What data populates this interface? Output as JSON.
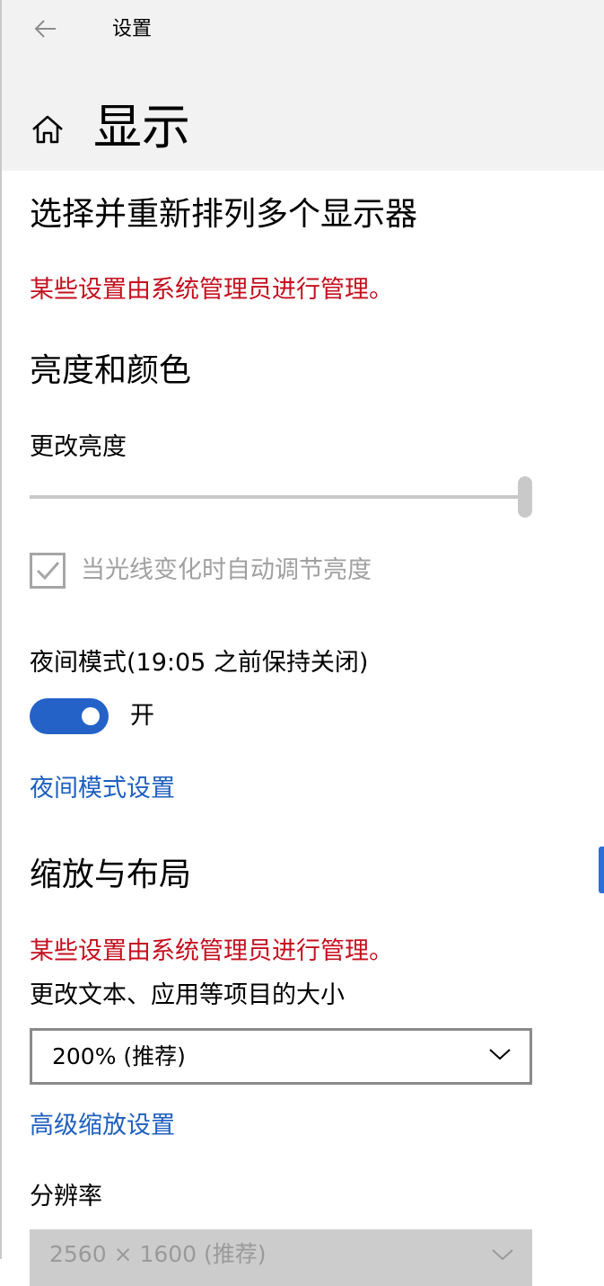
{
  "window": {
    "title": "设置"
  },
  "page": {
    "title": "显示"
  },
  "sections": {
    "arrange": {
      "title": "选择并重新排列多个显示器",
      "notice": "某些设置由系统管理员进行管理。"
    },
    "brightness": {
      "title": "亮度和颜色",
      "brightness_label": "更改亮度",
      "brightness_value_percent": 100,
      "auto_brightness_label": "当光线变化时自动调节亮度",
      "auto_brightness_checked": true,
      "night_light_label": "夜间模式(19:05 之前保持关闭)",
      "night_light_state": "开",
      "night_light_link": "夜间模式设置"
    },
    "scale": {
      "title": "缩放与布局",
      "notice": "某些设置由系统管理员进行管理。",
      "scale_label": "更改文本、应用等项目的大小",
      "scale_value": "200% (推荐)",
      "advanced_link": "高级缩放设置",
      "resolution_label": "分辨率",
      "resolution_value": "2560 × 1600 (推荐)"
    }
  },
  "colors": {
    "accent": "#2462c8",
    "link": "#1f5fbf",
    "warning": "#c50f1f",
    "header_bg": "#f2f2f2"
  }
}
